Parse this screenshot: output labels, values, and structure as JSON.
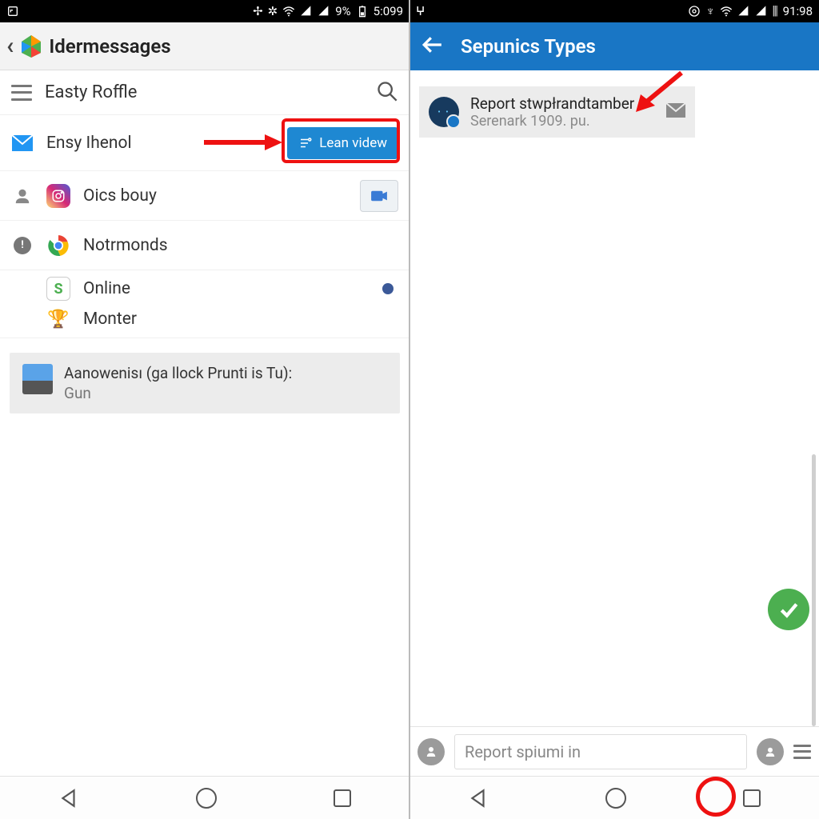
{
  "left": {
    "status": {
      "battery": "9%",
      "time": "5:099"
    },
    "title": "Idermessages",
    "search_name": "Easty Roffle",
    "rows": {
      "ensy": "Ensy Ihenol",
      "lean_btn": "Lean videw",
      "oics": "Oics bouy",
      "notr": "Notrmonds",
      "online": "Online",
      "monter": "Monter"
    },
    "card": {
      "line1": "Aanowenisı (ga llock Prunti is Tu):",
      "line2": "Gun"
    }
  },
  "right": {
    "status": {
      "time": "91:98"
    },
    "title": "Sepunics Types",
    "card": {
      "line1": "Report stwpłrandtamber",
      "line2": "Serenark 1909. pu."
    },
    "input_placeholder": "Report spiumi in"
  }
}
